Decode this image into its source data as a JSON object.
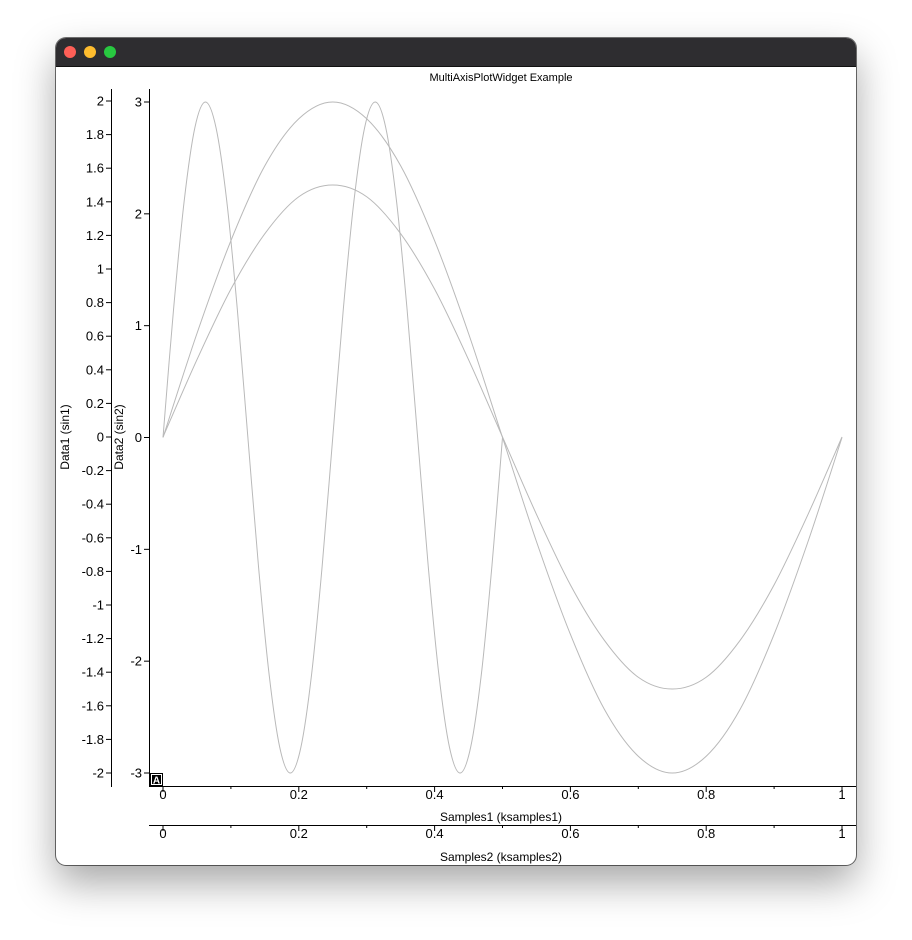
{
  "window": {
    "controls": {
      "close_icon": "close-icon",
      "minimize_icon": "minimize-icon",
      "maximize_icon": "maximize-icon",
      "close_color": "#fe5f57",
      "minimize_color": "#febc2e",
      "maximize_color": "#28c840"
    },
    "titlebar_color": "#2e2d30"
  },
  "chart_data": {
    "type": "line",
    "title": "MultiAxisPlotWidget Example",
    "corner_badge": "A",
    "colors": {
      "curve": "#b9b9b9",
      "axis": "#000000"
    },
    "x_axes": [
      {
        "id": "samples1",
        "label": "Samples1 (ksamples1)",
        "range": [
          0,
          1
        ],
        "ticks": [
          "0",
          "0.2",
          "0.4",
          "0.6",
          "0.8",
          "1"
        ]
      },
      {
        "id": "samples2",
        "label": "Samples2 (ksamples2)",
        "range": [
          0,
          1
        ],
        "ticks": [
          "0",
          "0.2",
          "0.4",
          "0.6",
          "0.8",
          "1"
        ]
      }
    ],
    "y_axes": [
      {
        "id": "data1",
        "label": "Data1 (sin1)",
        "range": [
          -2,
          2
        ],
        "ticks": [
          "2",
          "1.8",
          "1.6",
          "1.4",
          "1.2",
          "1",
          "0.8",
          "0.6",
          "0.4",
          "0.2",
          "0",
          "-0.2",
          "-0.4",
          "-0.6",
          "-0.8",
          "-1",
          "-1.2",
          "-1.4",
          "-1.6",
          "-1.8",
          "-2"
        ]
      },
      {
        "id": "data2",
        "label": "Data2 (sin2)",
        "range": [
          -3,
          3
        ],
        "ticks": [
          "3",
          "2",
          "1",
          "0",
          "-1",
          "-2",
          "-3"
        ]
      }
    ],
    "series": [
      {
        "x_axis": "samples1",
        "y_axis": "data1",
        "description": "1.5 * sin(2πx)",
        "x": [
          0,
          0.05,
          0.1,
          0.15,
          0.2,
          0.25,
          0.3,
          0.35,
          0.4,
          0.45,
          0.5,
          0.55,
          0.6,
          0.65,
          0.7,
          0.75,
          0.8,
          0.85,
          0.9,
          0.95,
          1
        ],
        "y": [
          0,
          0.46,
          0.88,
          1.21,
          1.43,
          1.5,
          1.43,
          1.21,
          0.88,
          0.46,
          0,
          -0.46,
          -0.88,
          -1.21,
          -1.43,
          -1.5,
          -1.43,
          -1.21,
          -0.88,
          -0.46,
          0
        ]
      },
      {
        "x_axis": "samples1",
        "y_axis": "data2",
        "description": "3 * sin(2πx)",
        "x": [
          0,
          0.05,
          0.1,
          0.15,
          0.2,
          0.25,
          0.3,
          0.35,
          0.4,
          0.45,
          0.5,
          0.55,
          0.6,
          0.65,
          0.7,
          0.75,
          0.8,
          0.85,
          0.9,
          0.95,
          1
        ],
        "y": [
          0,
          0.93,
          1.76,
          2.43,
          2.85,
          3.0,
          2.85,
          2.43,
          1.76,
          0.93,
          0,
          -0.93,
          -1.76,
          -2.43,
          -2.85,
          -3.0,
          -2.85,
          -2.43,
          -1.76,
          -0.93,
          0
        ]
      },
      {
        "x_axis": "samples2",
        "y_axis": "data2",
        "description": "3 * sin(8πx) on x in [0, 0.5]",
        "x": [
          0,
          0.0156,
          0.0313,
          0.0469,
          0.0625,
          0.0781,
          0.0938,
          0.1094,
          0.125,
          0.1406,
          0.1563,
          0.1719,
          0.1875,
          0.2031,
          0.2188,
          0.2344,
          0.25,
          0.2656,
          0.2813,
          0.2969,
          0.3125,
          0.3281,
          0.3438,
          0.3594,
          0.375,
          0.3906,
          0.4063,
          0.4219,
          0.4375,
          0.4531,
          0.4688,
          0.4844,
          0.5
        ],
        "y": [
          0,
          1.15,
          2.12,
          2.77,
          3.0,
          2.77,
          2.12,
          1.15,
          0,
          -1.15,
          -2.12,
          -2.77,
          -3.0,
          -2.77,
          -2.12,
          -1.15,
          0,
          1.15,
          2.12,
          2.77,
          3.0,
          2.77,
          2.12,
          1.15,
          0,
          -1.15,
          -2.12,
          -2.77,
          -3.0,
          -2.77,
          -2.12,
          -1.15,
          0
        ]
      }
    ]
  }
}
